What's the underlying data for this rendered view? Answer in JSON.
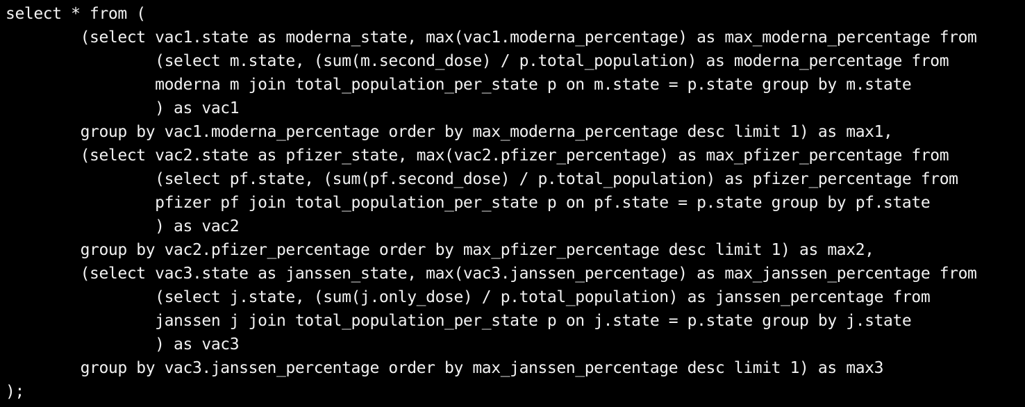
{
  "terminal": {
    "background_color": "#000000",
    "text_color": "#f2f2f2",
    "lines": [
      "select * from (",
      "        (select vac1.state as moderna_state, max(vac1.moderna_percentage) as max_moderna_percentage from",
      "                (select m.state, (sum(m.second_dose) / p.total_population) as moderna_percentage from",
      "                moderna m join total_population_per_state p on m.state = p.state group by m.state",
      "                ) as vac1",
      "        group by vac1.moderna_percentage order by max_moderna_percentage desc limit 1) as max1,",
      "        (select vac2.state as pfizer_state, max(vac2.pfizer_percentage) as max_pfizer_percentage from",
      "                (select pf.state, (sum(pf.second_dose) / p.total_population) as pfizer_percentage from",
      "                pfizer pf join total_population_per_state p on pf.state = p.state group by pf.state",
      "                ) as vac2",
      "        group by vac2.pfizer_percentage order by max_pfizer_percentage desc limit 1) as max2,",
      "        (select vac3.state as janssen_state, max(vac3.janssen_percentage) as max_janssen_percentage from",
      "                (select j.state, (sum(j.only_dose) / p.total_population) as janssen_percentage from",
      "                janssen j join total_population_per_state p on j.state = p.state group by j.state",
      "                ) as vac3",
      "        group by vac3.janssen_percentage order by max_janssen_percentage desc limit 1) as max3",
      ");"
    ]
  }
}
